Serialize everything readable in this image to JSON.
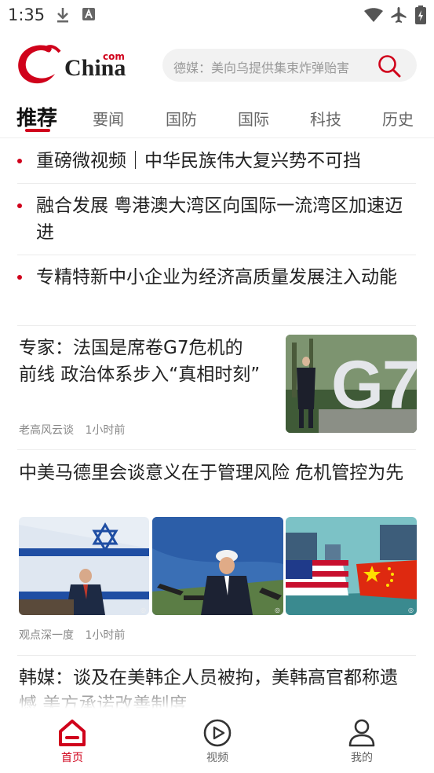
{
  "status_bar": {
    "time": "1:35"
  },
  "header": {
    "logo_text": "China",
    "logo_suffix": "com",
    "search_placeholder": "德媒：美向乌提供集束炸弹贻害"
  },
  "tabs": [
    "推荐",
    "要闻",
    "国防",
    "国际",
    "科技",
    "历史"
  ],
  "headlines": [
    "重磅微视频｜中华民族伟大复兴势不可挡",
    "融合发展 粤港澳大湾区向国际一流湾区加速迈进",
    "专精特新中小企业为经济高质量发展注入动能"
  ],
  "articles": [
    {
      "title": "专家：法国是席卷G7危机的前线 政治体系步入“真相时刻”",
      "source": "老高风云谈",
      "time": "1小时前",
      "image_text": "G7"
    },
    {
      "title": "中美马德里会谈意义在于管理风险 危机管控为先",
      "source": "观点深一度",
      "time": "1小时前"
    },
    {
      "title": "韩媒：谈及在美韩企人员被拘，美韩高官都称遗憾 美方承诺改善制度"
    }
  ],
  "bottom_nav": [
    {
      "label": "首页",
      "icon": "home-icon",
      "active": true
    },
    {
      "label": "视频",
      "icon": "video-play-icon",
      "active": false
    },
    {
      "label": "我的",
      "icon": "profile-icon",
      "active": false
    }
  ],
  "colors": {
    "accent": "#d0021b",
    "text": "#222222",
    "meta": "#888888"
  }
}
